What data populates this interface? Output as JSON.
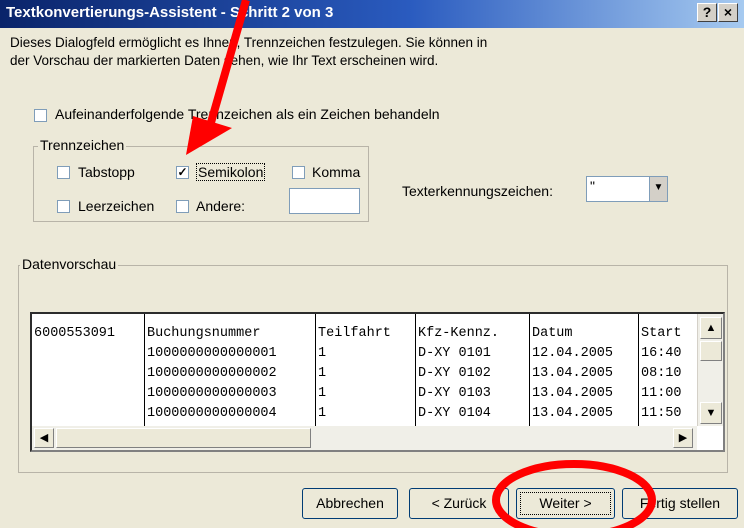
{
  "window": {
    "title": "Textkonvertierungs-Assistent - Schritt 2 von 3",
    "help_button": "?",
    "close_button": "×"
  },
  "description": {
    "line1": "Dieses Dialogfeld ermöglicht es Ihnen, Trennzeichen festzulegen. Sie können in",
    "line2": "der Vorschau der markierten Daten sehen, wie Ihr Text erscheinen wird."
  },
  "consecutive_checkbox": {
    "label": "Aufeinanderfolgende Trennzeichen als ein Zeichen behandeln",
    "checked": false
  },
  "delimiters": {
    "legend": "Trennzeichen",
    "tab": {
      "label": "Tabstopp",
      "checked": false
    },
    "semicolon": {
      "label": "Semikolon",
      "checked": true
    },
    "comma": {
      "label": "Komma",
      "checked": false
    },
    "space": {
      "label": "Leerzeichen",
      "checked": false
    },
    "other": {
      "label": "Andere:",
      "checked": false,
      "value": ""
    }
  },
  "text_qualifier": {
    "label": "Texterkennungszeichen:",
    "value": "\""
  },
  "preview": {
    "legend": "Datenvorschau",
    "columns": [
      [
        "6000553091",
        "",
        "",
        "",
        ""
      ],
      [
        "Buchungsnummer",
        "1000000000000001",
        "1000000000000002",
        "1000000000000003",
        "1000000000000004"
      ],
      [
        "Teilfahrt",
        "1",
        "1",
        "1",
        "1"
      ],
      [
        "Kfz-Kennz.",
        "D-XY 0101",
        "D-XY 0102",
        "D-XY 0103",
        "D-XY 0104"
      ],
      [
        "Datum",
        "12.04.2005",
        "13.04.2005",
        "13.04.2005",
        "13.04.2005"
      ],
      [
        "Start",
        "16:40",
        "08:10",
        "11:00",
        "11:50"
      ]
    ]
  },
  "buttons": {
    "cancel": "Abbrechen",
    "back": "< Zurück",
    "next": "Weiter >",
    "finish": "Fertig stellen"
  }
}
